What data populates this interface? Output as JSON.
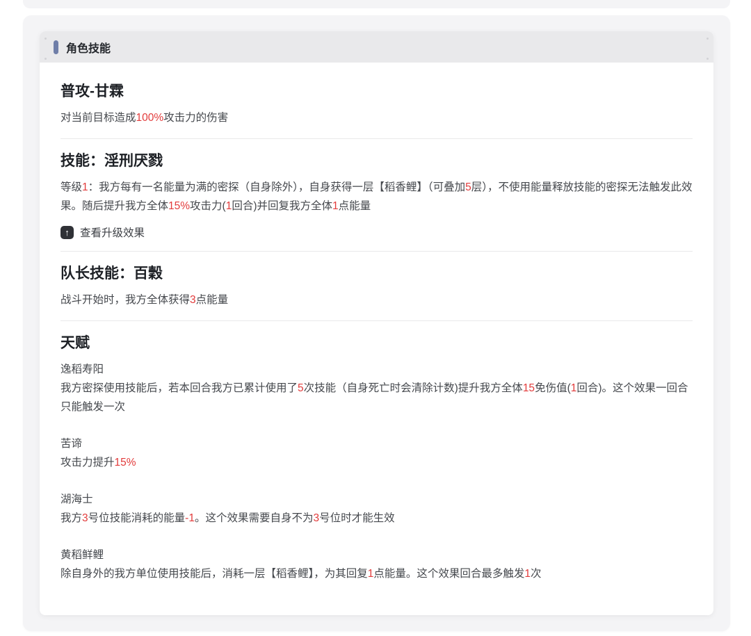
{
  "header": {
    "title": "角色技能"
  },
  "colors": {
    "highlight": "#e23b3b",
    "accent_bar": "#6f7ea8",
    "header_bg": "#e9e9eb",
    "outer_card_bg": "#f4f4f6"
  },
  "sections": {
    "basic": {
      "title": "普攻-甘霖",
      "desc": [
        {
          "t": "对当前目标造成"
        },
        {
          "t": "100%",
          "hl": true
        },
        {
          "t": "攻击力的伤害"
        }
      ]
    },
    "skill": {
      "title": "技能：淫刑厌戮",
      "desc": [
        {
          "t": "等级"
        },
        {
          "t": "1",
          "hl": true
        },
        {
          "t": "：我方每有一名能量为满的密探（自身除外），自身获得一层【稻香鲤】（可叠加"
        },
        {
          "t": "5",
          "hl": true
        },
        {
          "t": "层），不使用能量释放技能的密探无法触发此效果。随后提升我方全体"
        },
        {
          "t": "15%",
          "hl": true
        },
        {
          "t": "攻击力("
        },
        {
          "t": "1",
          "hl": true
        },
        {
          "t": "回合)并回复我方全体"
        },
        {
          "t": "1",
          "hl": true
        },
        {
          "t": "点能量"
        }
      ],
      "upgrade_label": "查看升级效果",
      "upgrade_icon_glyph": "↑"
    },
    "leader": {
      "title": "队长技能：百穀",
      "desc": [
        {
          "t": "战斗开始时，我方全体获得"
        },
        {
          "t": "3",
          "hl": true
        },
        {
          "t": "点能量"
        }
      ]
    },
    "talents": {
      "title": "天赋",
      "items": [
        {
          "name": "逸稻寿阳",
          "desc": [
            {
              "t": "我方密探使用技能后，若本回合我方已累计使用了"
            },
            {
              "t": "5",
              "hl": true
            },
            {
              "t": "次技能（自身死亡时会清除计数)提升我方全体"
            },
            {
              "t": "15",
              "hl": true
            },
            {
              "t": "免伤值("
            },
            {
              "t": "1",
              "hl": true
            },
            {
              "t": "回合)。这个效果一回合只能触发一次"
            }
          ]
        },
        {
          "name": "苦谛",
          "desc": [
            {
              "t": "攻击力提升"
            },
            {
              "t": "15%",
              "hl": true
            }
          ]
        },
        {
          "name": "湖海士",
          "desc": [
            {
              "t": "我方"
            },
            {
              "t": "3",
              "hl": true
            },
            {
              "t": "号位技能消耗的能量"
            },
            {
              "t": "-1",
              "hl": true
            },
            {
              "t": "。这个效果需要自身不为"
            },
            {
              "t": "3",
              "hl": true
            },
            {
              "t": "号位时才能生效"
            }
          ]
        },
        {
          "name": "黄稻鲜鲤",
          "desc": [
            {
              "t": "除自身外的我方单位使用技能后，消耗一层【稻香鲤】，为其回复"
            },
            {
              "t": "1",
              "hl": true
            },
            {
              "t": "点能量。这个效果回合最多触发"
            },
            {
              "t": "1",
              "hl": true
            },
            {
              "t": "次"
            }
          ]
        }
      ]
    }
  }
}
